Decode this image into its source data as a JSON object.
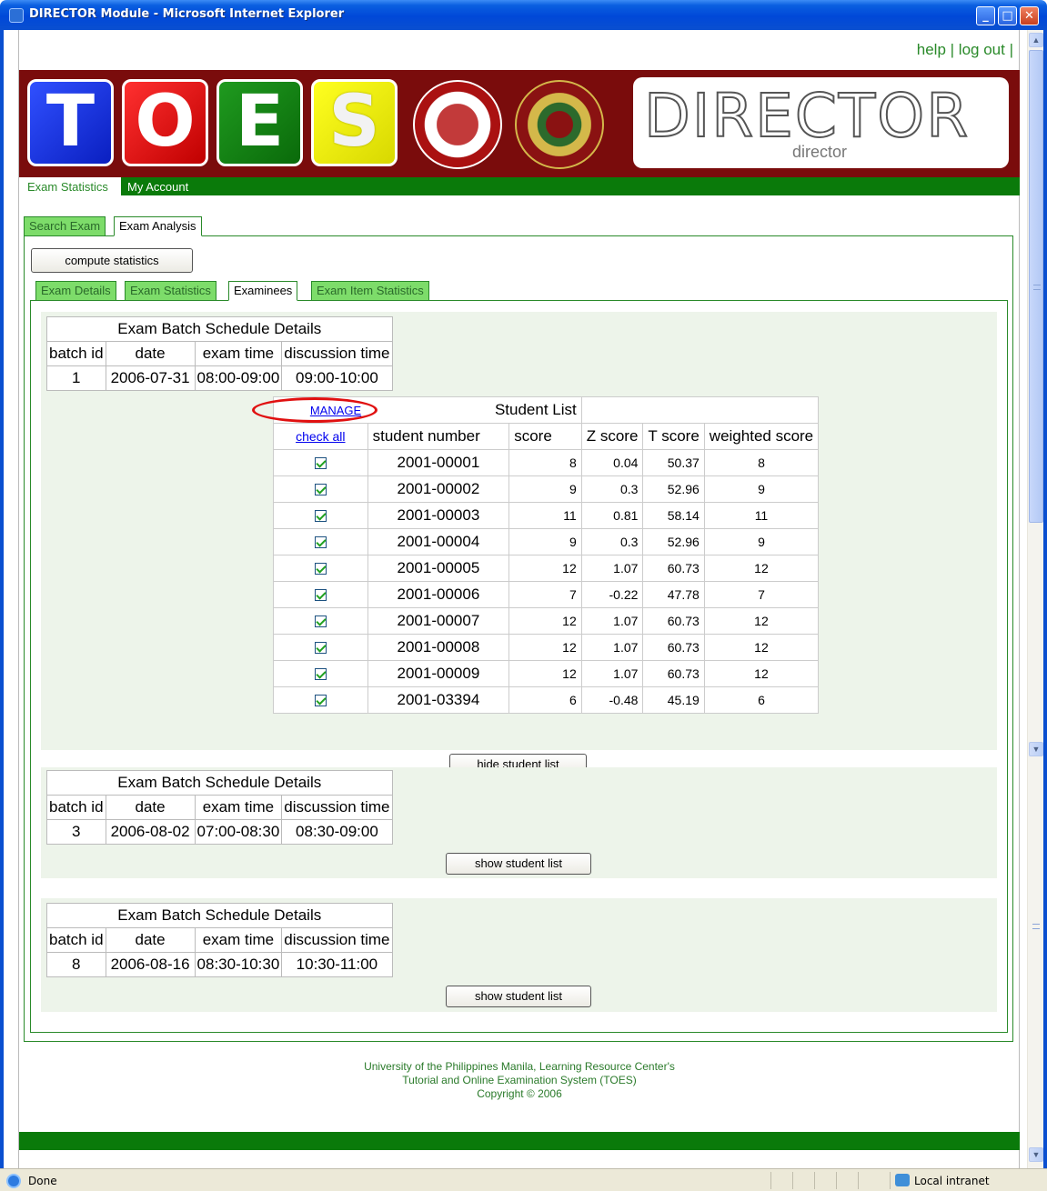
{
  "window": {
    "title": "DIRECTOR Module - Microsoft Internet Explorer",
    "min_glyph": "_",
    "max_glyph": "□",
    "close_glyph": "✕"
  },
  "header": {
    "help_label": "help",
    "logout_label": "log out",
    "tiles": [
      "T",
      "O",
      "E",
      "S"
    ],
    "role_title": "DIRECTOR",
    "role_sub": "director"
  },
  "menu": {
    "items": [
      "Exam Statistics",
      "My Account"
    ]
  },
  "tabs_top": [
    "Search Exam",
    "Exam Analysis"
  ],
  "compute_label": "compute statistics",
  "tabs_inner": [
    "Exam Details",
    "Exam Statistics",
    "Examinees",
    "Exam Item Statistics"
  ],
  "schedule_headers": {
    "title": "Exam Batch Schedule Details",
    "cols": [
      "batch id",
      "date",
      "exam time",
      "discussion time"
    ]
  },
  "batches": [
    {
      "batch_id": "1",
      "date": "2006-07-31",
      "exam_time": "08:00-09:00",
      "discussion_time": "09:00-10:00",
      "button": "hide student list"
    },
    {
      "batch_id": "3",
      "date": "2006-08-02",
      "exam_time": "07:00-08:30",
      "discussion_time": "08:30-09:00",
      "button": "show student list"
    },
    {
      "batch_id": "8",
      "date": "2006-08-16",
      "exam_time": "08:30-10:30",
      "discussion_time": "10:30-11:00",
      "button": "show student list"
    }
  ],
  "student_list": {
    "manage_label": "MANAGE",
    "title": "Student List",
    "check_all_label": "check all",
    "cols": [
      "student number",
      "score",
      "Z score",
      "T score",
      "weighted score"
    ],
    "rows": [
      {
        "number": "2001-00001",
        "score": "8",
        "z": "0.04",
        "t": "50.37",
        "w": "8"
      },
      {
        "number": "2001-00002",
        "score": "9",
        "z": "0.3",
        "t": "52.96",
        "w": "9"
      },
      {
        "number": "2001-00003",
        "score": "11",
        "z": "0.81",
        "t": "58.14",
        "w": "11"
      },
      {
        "number": "2001-00004",
        "score": "9",
        "z": "0.3",
        "t": "52.96",
        "w": "9"
      },
      {
        "number": "2001-00005",
        "score": "12",
        "z": "1.07",
        "t": "60.73",
        "w": "12"
      },
      {
        "number": "2001-00006",
        "score": "7",
        "z": "-0.22",
        "t": "47.78",
        "w": "7"
      },
      {
        "number": "2001-00007",
        "score": "12",
        "z": "1.07",
        "t": "60.73",
        "w": "12"
      },
      {
        "number": "2001-00008",
        "score": "12",
        "z": "1.07",
        "t": "60.73",
        "w": "12"
      },
      {
        "number": "2001-00009",
        "score": "12",
        "z": "1.07",
        "t": "60.73",
        "w": "12"
      },
      {
        "number": "2001-03394",
        "score": "6",
        "z": "-0.48",
        "t": "45.19",
        "w": "6"
      }
    ]
  },
  "footer": {
    "line1": "University of the Philippines Manila, Learning Resource Center's",
    "line2": "Tutorial and Online Examination System (TOES)",
    "line3": "Copyright © 2006"
  },
  "status": {
    "text": "Done",
    "zone": "Local intranet"
  },
  "icons": {
    "app": "ie-page-icon",
    "status": "ie-globe-icon",
    "zone": "intranet-icon"
  }
}
